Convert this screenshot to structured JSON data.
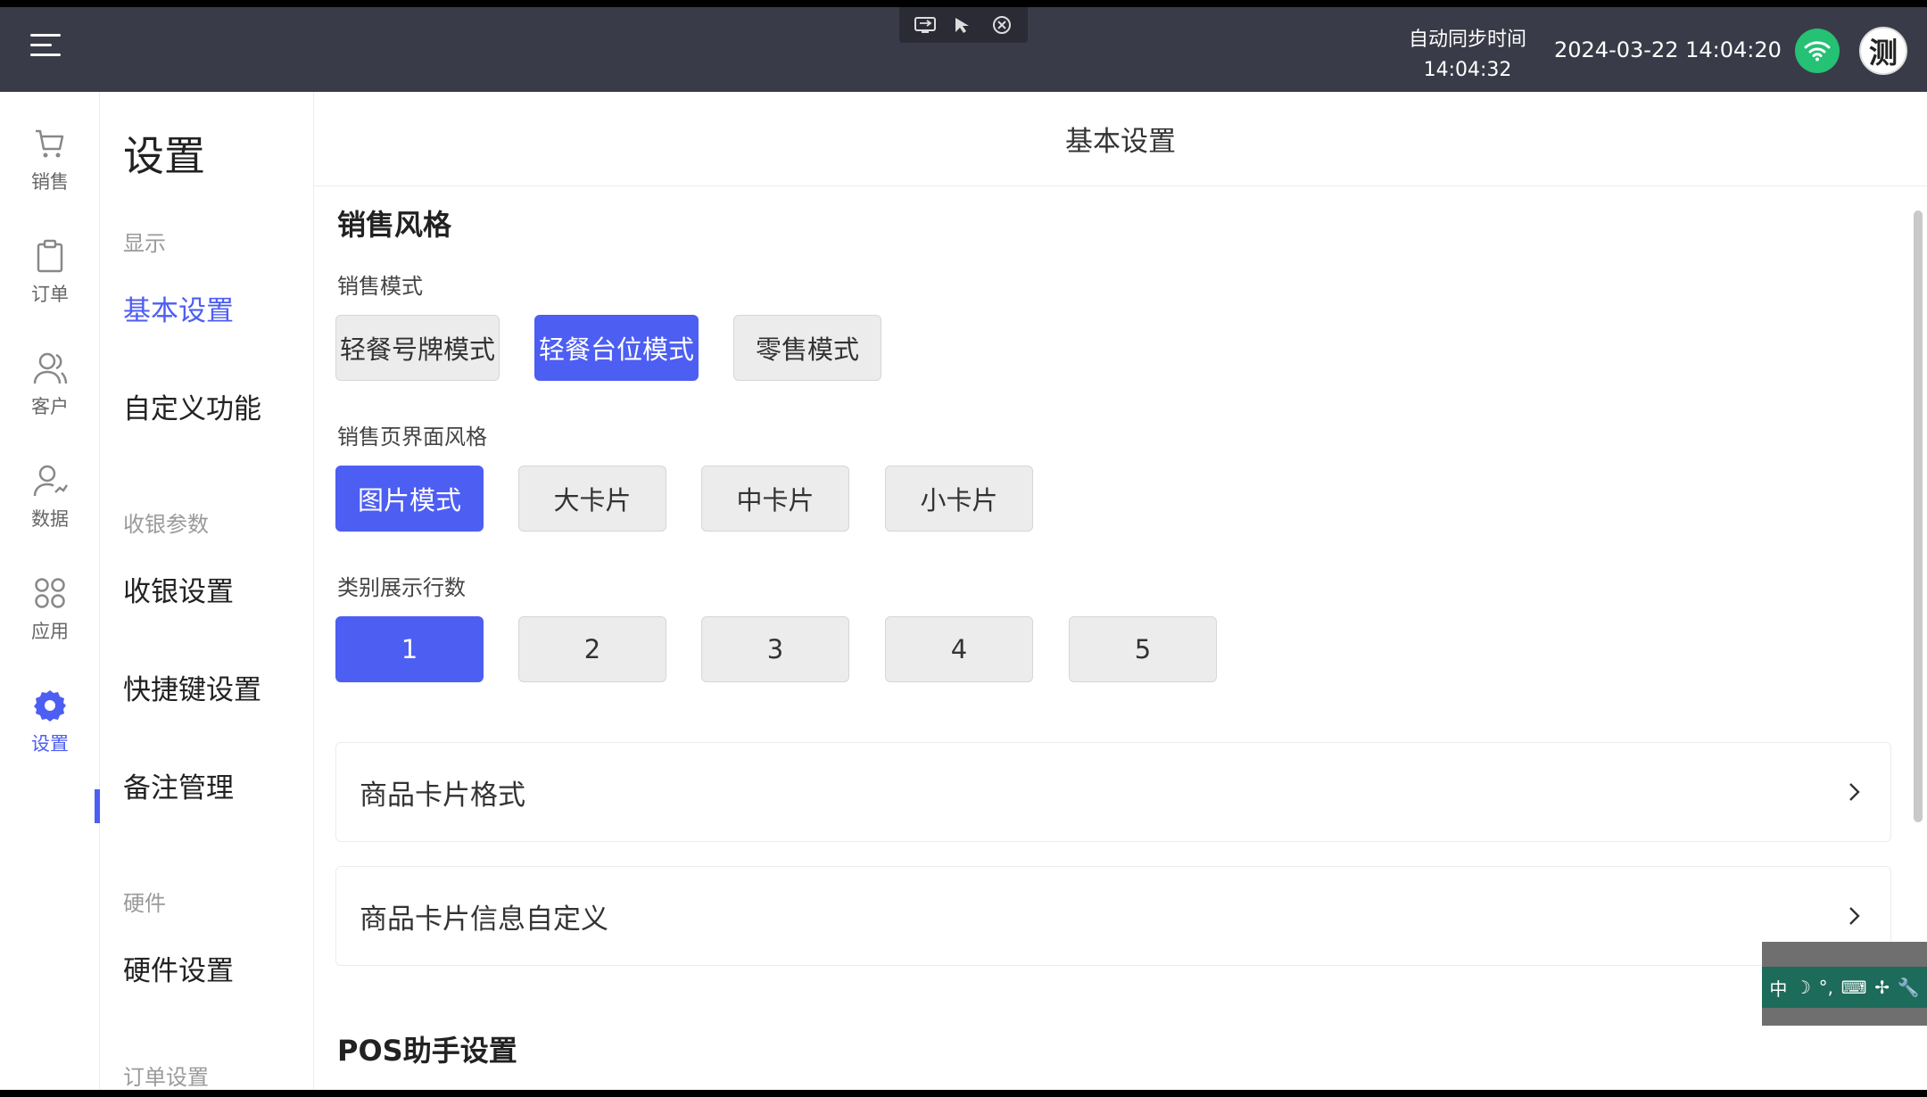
{
  "topbar": {
    "sync_label": "自动同步时间",
    "sync_time": "14:04:32",
    "datetime": "2024-03-22 14:04:20",
    "avatar_text": "测"
  },
  "iconnav": {
    "items": [
      {
        "label": "销售",
        "icon": "cart-icon"
      },
      {
        "label": "订单",
        "icon": "clipboard-icon"
      },
      {
        "label": "客户",
        "icon": "users-icon"
      },
      {
        "label": "数据",
        "icon": "user-chart-icon"
      },
      {
        "label": "应用",
        "icon": "apps-icon"
      },
      {
        "label": "设置",
        "icon": "gear-icon"
      }
    ],
    "active_index": 5
  },
  "submenu": {
    "title": "设置",
    "groups": [
      {
        "label": "显示"
      },
      {
        "label": "收银参数"
      },
      {
        "label": "硬件"
      },
      {
        "label": "订单设置"
      }
    ],
    "items": [
      {
        "label": "基本设置"
      },
      {
        "label": "自定义功能"
      },
      {
        "label": "收银设置"
      },
      {
        "label": "快捷键设置"
      },
      {
        "label": "备注管理"
      },
      {
        "label": "硬件设置"
      }
    ]
  },
  "main": {
    "header": "基本设置",
    "section_sales_style": "销售风格",
    "sales_mode": {
      "label": "销售模式",
      "options": [
        "轻餐号牌模式",
        "轻餐台位模式",
        "零售模式"
      ],
      "selected": "轻餐台位模式"
    },
    "page_style": {
      "label": "销售页界面风格",
      "options": [
        "图片模式",
        "大卡片",
        "中卡片",
        "小卡片"
      ],
      "selected": "图片模式"
    },
    "category_rows": {
      "label": "类别展示行数",
      "options": [
        "1",
        "2",
        "3",
        "4",
        "5"
      ],
      "selected": "1"
    },
    "rows": [
      {
        "label": "商品卡片格式"
      },
      {
        "label": "商品卡片信息自定义"
      }
    ],
    "section_pos": "POS助手设置"
  },
  "ime": {
    "items": [
      "中",
      "☽",
      "°,",
      "⌨",
      "✢",
      "🔧"
    ]
  },
  "colors": {
    "accent": "#4d5ef2",
    "topbar": "#3a3b48",
    "wifi": "#25c174"
  }
}
